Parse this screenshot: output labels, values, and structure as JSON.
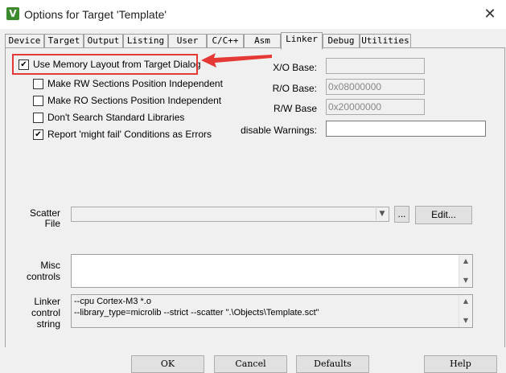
{
  "window": {
    "title": "Options for Target 'Template'",
    "app_icon_glyph": "V",
    "close_glyph": "✕"
  },
  "tabs": [
    {
      "label": "Device"
    },
    {
      "label": "Target"
    },
    {
      "label": "Output"
    },
    {
      "label": "Listing"
    },
    {
      "label": "User"
    },
    {
      "label": "C/C++"
    },
    {
      "label": "Asm"
    },
    {
      "label": "Linker",
      "active": true
    },
    {
      "label": "Debug"
    },
    {
      "label": "Utilities"
    }
  ],
  "linker": {
    "options": [
      {
        "label": "Use Memory Layout from Target Dialog",
        "checked": true
      },
      {
        "label": "Make RW Sections Position Independent",
        "checked": false
      },
      {
        "label": "Make RO Sections Position Independent",
        "checked": false
      },
      {
        "label": "Don't Search Standard Libraries",
        "checked": false
      },
      {
        "label": "Report 'might fail' Conditions as Errors",
        "checked": true
      }
    ],
    "xo_base": {
      "label": "X/O Base:",
      "value": ""
    },
    "ro_base": {
      "label": "R/O Base:",
      "value": "0x08000000"
    },
    "rw_base": {
      "label": "R/W Base",
      "value": "0x20000000"
    },
    "disable_warnings": {
      "label": "disable Warnings:",
      "value": ""
    },
    "scatter_file": {
      "label_line1": "Scatter",
      "label_line2": "File",
      "value": "",
      "browse_label": "...",
      "edit_label": "Edit..."
    },
    "misc_controls": {
      "label_line1": "Misc",
      "label_line2": "controls",
      "value": ""
    },
    "linker_control_string": {
      "label_line1": "Linker",
      "label_line2": "control",
      "label_line3": "string",
      "lines": [
        "--cpu Cortex-M3 *.o",
        "--library_type=microlib --strict --scatter \".\\Objects\\Template.sct\""
      ]
    }
  },
  "footer": {
    "ok_label": "OK",
    "cancel_label": "Cancel",
    "defaults_label": "Defaults",
    "help_label": "Help"
  },
  "colors": {
    "highlight": "#e53935",
    "app_icon": "#3c8a2e"
  },
  "icons": {
    "check": "✔",
    "scroll_up": "▲",
    "scroll_down": "▼",
    "combo_dropdown": "▼"
  }
}
